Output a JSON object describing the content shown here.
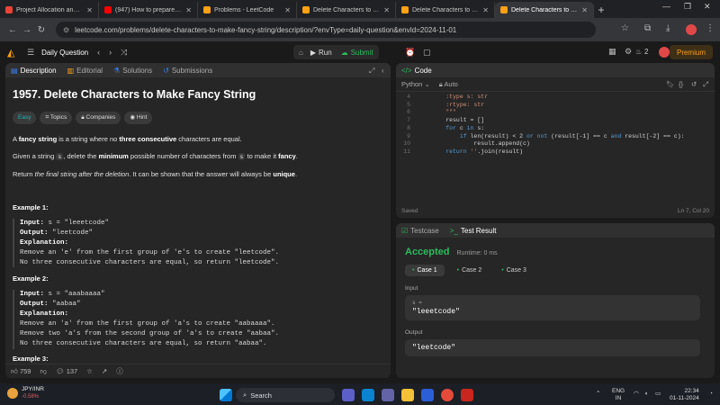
{
  "browser": {
    "tabs": [
      {
        "title": "Project Allocation and Gui",
        "color": "#ea4335"
      },
      {
        "title": "(947) How to prepare for p",
        "color": "#ff0000"
      },
      {
        "title": "Problems - LeetCode",
        "color": "#ffa116"
      },
      {
        "title": "Delete Characters to Make",
        "color": "#ffa116"
      },
      {
        "title": "Delete Characters to Make",
        "color": "#ffa116"
      },
      {
        "title": "Delete Characters to Make",
        "color": "#ffa116"
      }
    ],
    "url": "leetcode.com/problems/delete-characters-to-make-fancy-string/description/?envType=daily-question&envId=2024-11-01"
  },
  "header": {
    "daily_label": "Daily Question",
    "run_label": "Run",
    "submit_label": "Submit",
    "streak_count": "2",
    "premium_label": "Premium"
  },
  "description_panel": {
    "tabs": {
      "description": "Description",
      "editorial": "Editorial",
      "solutions": "Solutions",
      "submissions": "Submissions"
    },
    "title": "1957. Delete Characters to Make Fancy String",
    "pills": {
      "difficulty": "Easy",
      "topics": "Topics",
      "companies": "Companies",
      "hint": "Hint"
    },
    "para1": {
      "a": "A ",
      "b": "fancy string",
      "c": " is a string where no ",
      "d": "three consecutive",
      "e": " characters are equal."
    },
    "para2": {
      "a": "Given a string ",
      "b": "s",
      "c": ", delete the ",
      "d": "minimum",
      "e": " possible number of characters from ",
      "f": "s",
      "g": " to make it ",
      "h": "fancy",
      "i": "."
    },
    "para3": {
      "a": "Return ",
      "b": "the final string after the deletion",
      "c": ". It can be shown that the answer will always be ",
      "d": "unique",
      "e": "."
    },
    "examples": [
      {
        "heading": "Example 1:",
        "input": "s = \"leeetcode\"",
        "output": "\"leetcode\"",
        "explanation": [
          "Remove an 'e' from the first group of 'e's to create \"leetcode\".",
          "No three consecutive characters are equal, so return \"leetcode\"."
        ]
      },
      {
        "heading": "Example 2:",
        "input": "s = \"aaabaaaa\"",
        "output": "\"aabaa\"",
        "explanation": [
          "Remove an 'a' from the first group of 'a's to create \"aabaaaa\".",
          "Remove two 'a's from the second group of 'a's to create \"aabaa\".",
          "No three consecutive characters are equal, so return \"aabaa\"."
        ]
      },
      {
        "heading": "Example 3:"
      }
    ],
    "labels": {
      "input": "Input:",
      "output": "Output:",
      "explanation": "Explanation:"
    },
    "footer": {
      "likes": "759",
      "comments": "137"
    }
  },
  "code_panel": {
    "title": "Code",
    "language": "Python",
    "mode": "Auto",
    "status": "Saved",
    "cursor": "Ln 7, Col 20",
    "lines": [
      {
        "n": "4",
        "text": "        :type s: str"
      },
      {
        "n": "5",
        "text": "        :rtype: str"
      },
      {
        "n": "6",
        "text": "        \"\"\""
      },
      {
        "n": "7",
        "text": "        result = []"
      },
      {
        "n": "8",
        "text": "        for c in s:"
      },
      {
        "n": "9",
        "text": "            if len(result) < 2 or not (result[-1] == c and result[-2] == c):"
      },
      {
        "n": "10",
        "text": "                result.append(c)"
      },
      {
        "n": "11",
        "text": "        return ''.join(result)"
      }
    ]
  },
  "result_panel": {
    "tabs": {
      "testcase": "Testcase",
      "result": "Test Result"
    },
    "status": "Accepted",
    "runtime": "Runtime: 0 ms",
    "cases": [
      "Case 1",
      "Case 2",
      "Case 3"
    ],
    "input_label": "Input",
    "input_var": "s =",
    "input_value": "\"leeetcode\"",
    "output_label": "Output",
    "output_value": "\"leetcode\""
  },
  "taskbar": {
    "ticker_name": "JPY/INR",
    "ticker_change": "-0.58%",
    "search_label": "Search",
    "lang": "ENG",
    "region": "IN",
    "time": "22:34",
    "date": "01-11-2024"
  }
}
